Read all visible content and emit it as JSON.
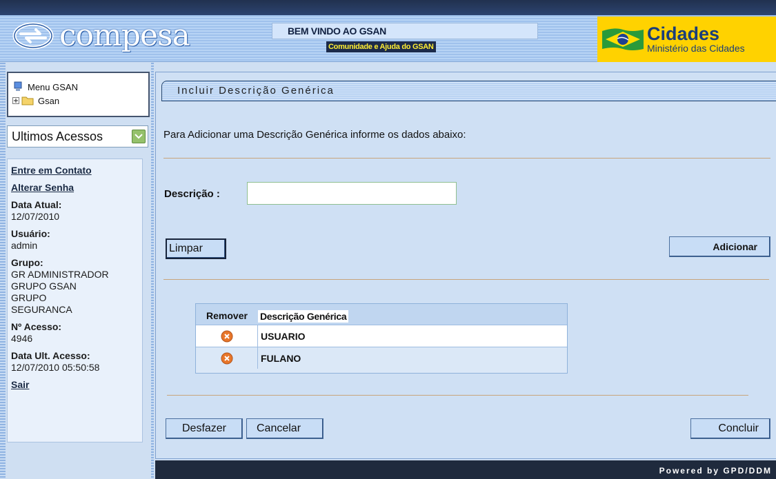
{
  "header": {
    "logo_text": "compesa",
    "welcome": "BEM VINDO AO GSAN",
    "community_link": "Comunidade e Ajuda do GSAN",
    "ministry_title": "Cidades",
    "ministry_subtitle": "Ministério das Cidades"
  },
  "sidebar": {
    "menu_title": "Menu GSAN",
    "menu_root": "Gsan",
    "recent_select": "Ultimos Acessos",
    "links": {
      "contact": "Entre em Contato",
      "change_password": "Alterar Senha",
      "logout": "Sair"
    },
    "info": {
      "date_label": "Data Atual:",
      "date_value": "12/07/2010",
      "user_label": "Usuário:",
      "user_value": "admin",
      "group_label": "Grupo:",
      "group_values": [
        "GR ADMINISTRADOR",
        "GRUPO GSAN",
        "GRUPO",
        "SEGURANCA"
      ],
      "access_label": "Nº Acesso:",
      "access_value": "4946",
      "last_access_label": "Data Ult. Acesso:",
      "last_access_value": "12/07/2010 05:50:58"
    }
  },
  "main": {
    "title": "Incluir Descrição Genérica",
    "intro": "Para Adicionar uma Descrição Genérica informe os dados abaixo:",
    "description_label": "Descrição :",
    "description_value": "",
    "buttons": {
      "clear": "Limpar",
      "add": "Adicionar",
      "undo": "Desfazer",
      "cancel": "Cancelar",
      "finish": "Concluir"
    },
    "table": {
      "headers": [
        "Remover",
        "Descrição Genérica"
      ],
      "rows": [
        {
          "description": "USUARIO"
        },
        {
          "description": "FULANO"
        }
      ]
    }
  },
  "footer": {
    "text": "Powered by GPD/DDM"
  },
  "colors": {
    "header_stripe": "#9fc1ec",
    "ministry_bg": "#ffd200",
    "panel_bg": "#cfe0f4",
    "footer_bg": "#1f2a3d",
    "remove_icon": "#e8762a"
  }
}
